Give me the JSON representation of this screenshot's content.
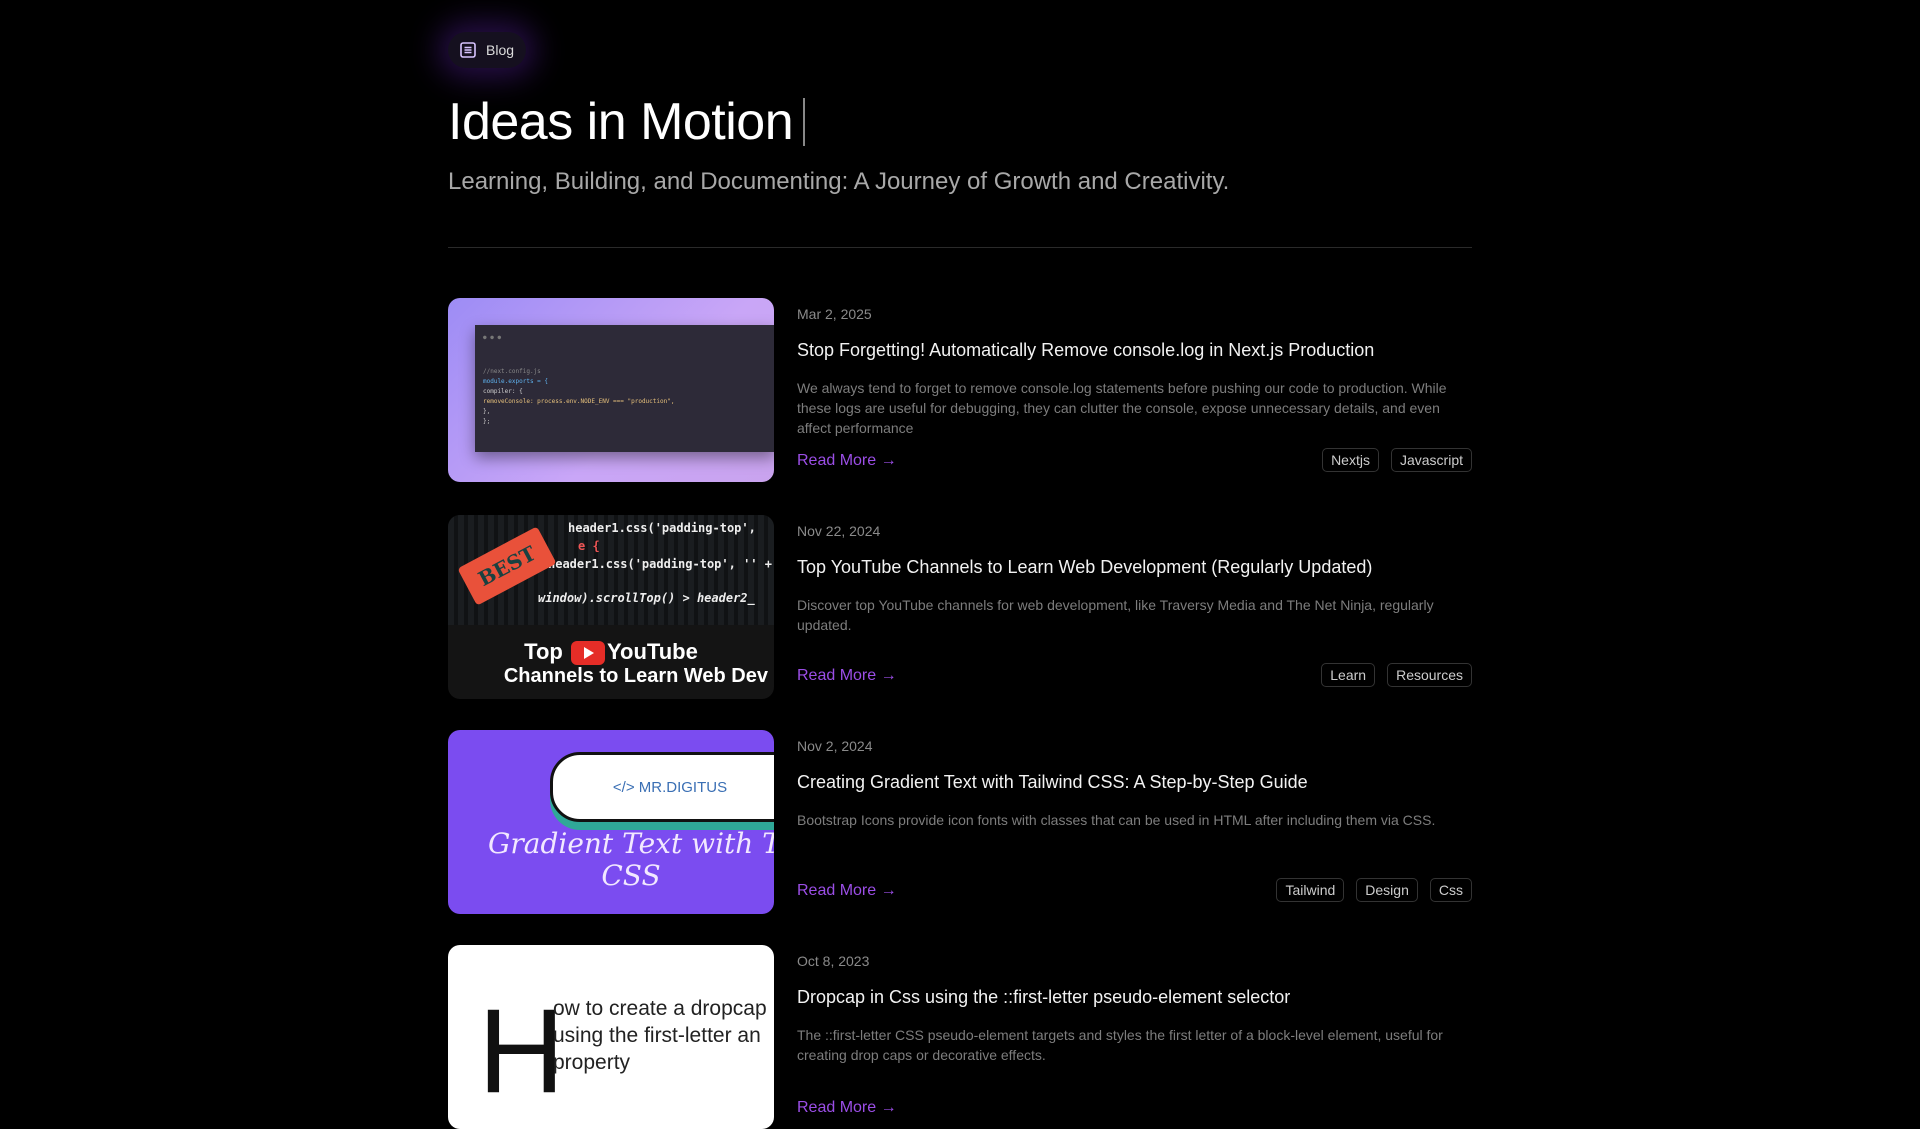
{
  "header": {
    "badge_label": "Blog",
    "badge_icon": "document-list-icon",
    "title": "Ideas in Motion",
    "subtitle": "Learning, Building, and Documenting: A Journey of Growth and Creativity."
  },
  "accent_color": "#9b4ee6",
  "posts": [
    {
      "date": "Mar 2, 2025",
      "title": "Stop Forgetting! Automatically Remove console.log in Next.js Production",
      "description": "We always tend to forget to remove console.log statements before pushing our code to production. While these logs are useful for debugging, they can clutter the console, expose unnecessary details, and even affect performance",
      "read_more": "Read More →",
      "tags": [
        "Nextjs",
        "Javascript"
      ],
      "thumb": {
        "lines": [
          "//next.config.js",
          "module.exports = {",
          "  compiler: {",
          "    removeConsole: process.env.NODE_ENV === \"production\",",
          "  },",
          "};"
        ]
      }
    },
    {
      "date": "Nov 22, 2024",
      "title": "Top YouTube Channels to Learn Web Development (Regularly Updated)",
      "description": "Discover top YouTube channels for web development, like Traversy Media and The Net Ninja, regularly updated.",
      "read_more": "Read More →",
      "tags": [
        "Learn",
        "Resources"
      ],
      "thumb": {
        "badge": "BEST",
        "line1a": "Top",
        "line1b": "YouTube",
        "line2": "Channels to Learn Web Dev",
        "code": [
          "header1.css('padding-top',",
          "e {",
          "header1.css('padding-top', '' +",
          "window).scrollTop() > header2_"
        ]
      }
    },
    {
      "date": "Nov 2, 2024",
      "title": "Creating Gradient Text with Tailwind CSS: A Step-by-Step Guide",
      "description": "Bootstrap Icons provide icon fonts with classes that can be used in HTML after including them via CSS.",
      "read_more": "Read More →",
      "tags": [
        "Tailwind",
        "Design",
        "Css"
      ],
      "thumb": {
        "brand": "</>  MR.DIGITUS",
        "line1": "Gradient Text with Tai",
        "line2": "CSS"
      }
    },
    {
      "date": "Oct 8, 2023",
      "title": "Dropcap in Css using the ::first-letter pseudo-element selector",
      "description": "The ::first-letter CSS pseudo-element targets and styles the first letter of a block-level element, useful for creating drop caps or decorative effects.",
      "read_more": "Read More →",
      "tags": [],
      "thumb": {
        "dropcap": "H",
        "lines": [
          "ow to create a dropcap",
          "using the first-letter an",
          "property"
        ]
      }
    }
  ]
}
